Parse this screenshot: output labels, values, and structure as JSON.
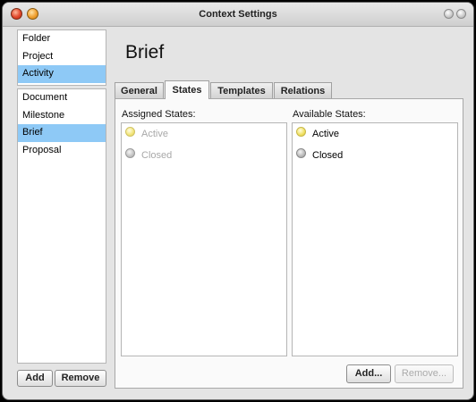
{
  "window": {
    "title": "Context Settings"
  },
  "sidebar": {
    "top_items": [
      {
        "label": "Folder",
        "selected": false
      },
      {
        "label": "Project",
        "selected": false
      },
      {
        "label": "Activity",
        "selected": true
      }
    ],
    "bottom_items": [
      {
        "label": "Document",
        "selected": false
      },
      {
        "label": "Milestone",
        "selected": false
      },
      {
        "label": "Brief",
        "selected": true
      },
      {
        "label": "Proposal",
        "selected": false
      }
    ],
    "add_label": "Add",
    "remove_label": "Remove"
  },
  "main": {
    "heading": "Brief",
    "tabs": [
      {
        "label": "General",
        "active": false
      },
      {
        "label": "States",
        "active": true
      },
      {
        "label": "Templates",
        "active": false
      },
      {
        "label": "Relations",
        "active": false
      }
    ],
    "assigned": {
      "label": "Assigned States:",
      "items": [
        {
          "label": "Active",
          "color": "yellow"
        },
        {
          "label": "Closed",
          "color": "gray"
        }
      ]
    },
    "available": {
      "label": "Available States:",
      "items": [
        {
          "label": "Active",
          "color": "yellow"
        },
        {
          "label": "Closed",
          "color": "gray"
        }
      ]
    },
    "add_label": "Add...",
    "remove_label": "Remove..."
  },
  "colors": {
    "selection": "#8ec9f6",
    "state_yellow": "#f0e060",
    "state_gray": "#b8b8b8"
  }
}
